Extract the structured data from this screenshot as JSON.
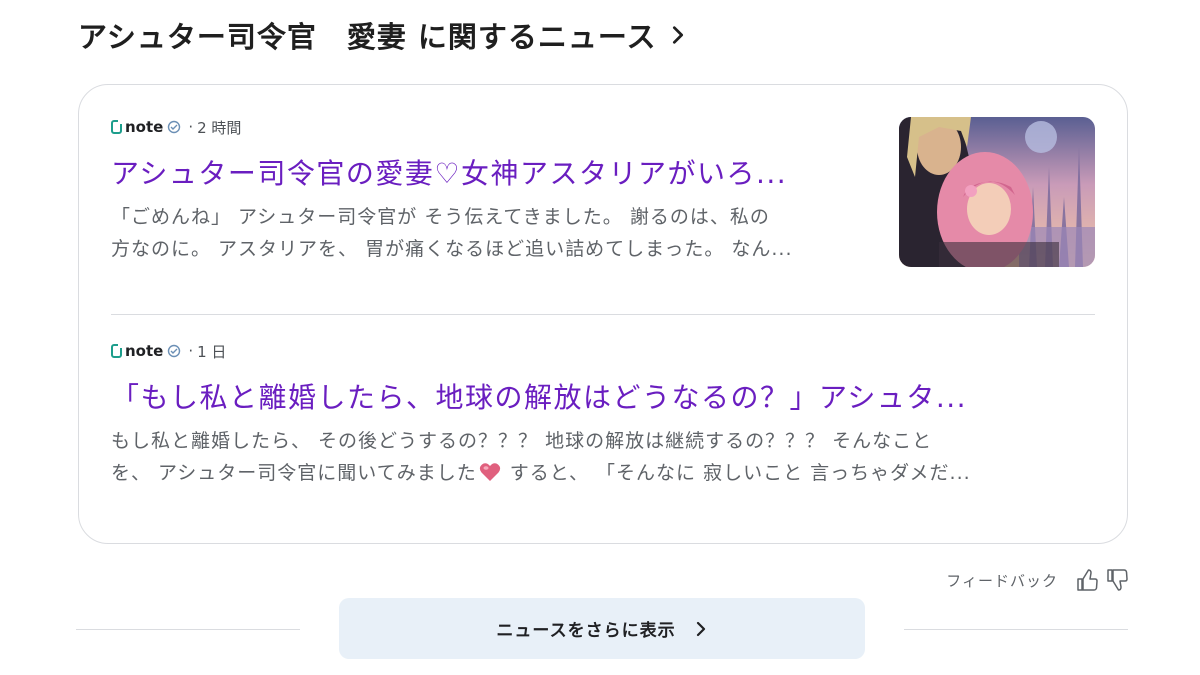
{
  "header": {
    "title": "アシュター司令官　愛妻 に関するニュース"
  },
  "articles": [
    {
      "source": "note",
      "time": "2 時間",
      "headline": "アシュター司令官の愛妻♡女神アスタリアがいろ...",
      "snippet_line1": "「ごめんね」 アシュター司令官が そう伝えてきました。 謝るのは、私の",
      "snippet_line2": "方なのに。 アスタリアを、 胃が痛くなるほど追い詰めてしまった。 なん..."
    },
    {
      "source": "note",
      "time": "1 日",
      "headline": "「もし私と離婚したら、地球の解放はどうなるの？」アシュタ...",
      "snippet_line1": "もし私と離婚したら、 その後どうするの？？？ 地球の解放は継続するの？？？ そんなこと",
      "snippet_line2a": "を、 アシュター司令官に聞いてみました",
      "snippet_line2b": " すると、 「そんなに 寂しいこと 言っちゃダメだ..."
    }
  ],
  "meta_separator": "·",
  "feedback": {
    "label": "フィードバック"
  },
  "more_button": {
    "label": "ニュースをさらに表示"
  },
  "colors": {
    "headline": "#6a1ec0",
    "button_bg": "#e8f0f8",
    "note_logo": "#1d9e8c"
  },
  "icons": [
    "chevron-right-icon",
    "note-logo-icon",
    "verified-icon",
    "heart-emoji-icon",
    "thumbs-up-icon",
    "thumbs-down-icon"
  ]
}
